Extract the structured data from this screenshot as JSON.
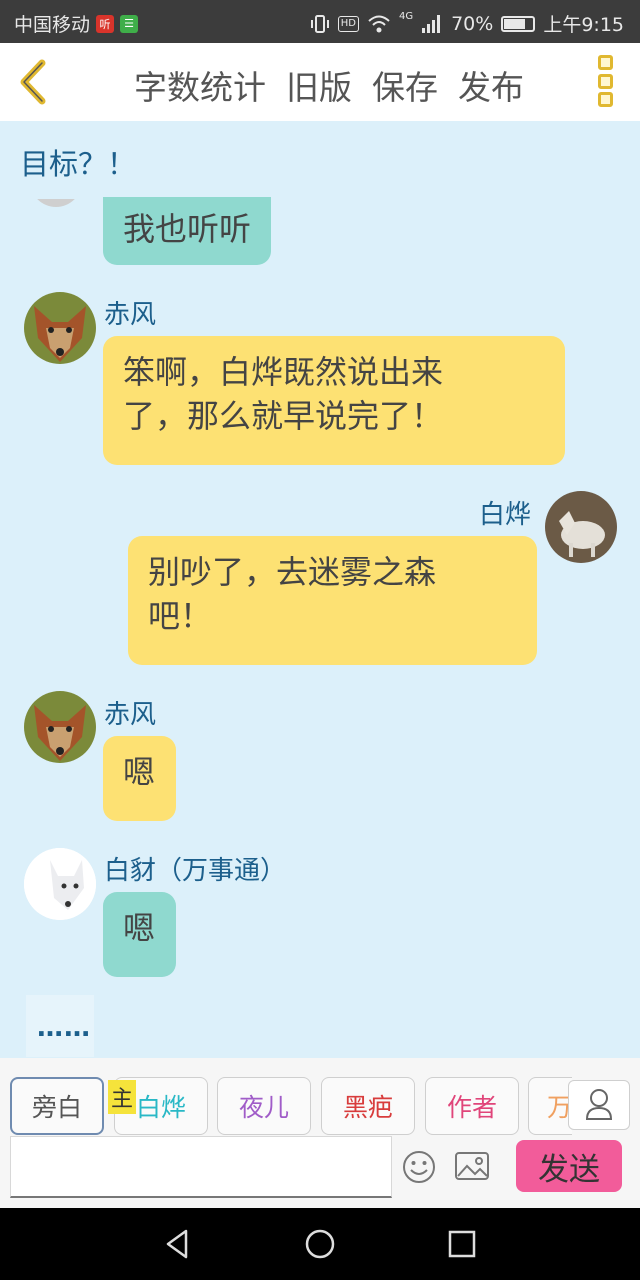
{
  "status_bar": {
    "carrier": "中国移动",
    "app1_glyph": "听",
    "app2_glyph": "☰",
    "network": "4G",
    "battery": "70%",
    "time": "上午9:15"
  },
  "toolbar": {
    "word_count": "字数统计",
    "old_version": "旧版",
    "save": "保存",
    "publish": "发布"
  },
  "chat": {
    "goal_text": "目标？！",
    "messages": [
      {
        "speaker": "",
        "text": "我也听听",
        "color": "teal",
        "side": "left"
      },
      {
        "speaker": "赤风",
        "text_line1": "笨啊，白烨既然说出来",
        "text_line2": "了，那么就早说完了！",
        "color": "yellow",
        "side": "left"
      },
      {
        "speaker": "白烨",
        "text_line1": "别吵了，去迷雾之森",
        "text_line2": "吧！",
        "color": "yellow",
        "side": "right"
      },
      {
        "speaker": "赤风",
        "text": "嗯",
        "color": "yellow",
        "side": "left"
      },
      {
        "speaker": "白豺（万事通）",
        "text": "嗯",
        "color": "teal",
        "side": "left"
      }
    ],
    "typing_dots": "……"
  },
  "roles": {
    "main_badge": "主",
    "items": [
      {
        "label": "旁白",
        "color": "#555555"
      },
      {
        "label": "白烨",
        "color": "#29b8c6"
      },
      {
        "label": "夜儿",
        "color": "#a05cc8"
      },
      {
        "label": "黑疤",
        "color": "#d83c3c"
      },
      {
        "label": "作者",
        "color": "#e0457a"
      },
      {
        "label": "万",
        "color": "#f0a060"
      }
    ]
  },
  "input": {
    "placeholder": "",
    "send_label": "发送"
  },
  "colors": {
    "chat_bg": "#dcf0fa",
    "bubble_yellow": "#fde173",
    "bubble_teal": "#8fd9cf",
    "send_button": "#f25c9a",
    "name_text": "#1c5f8c"
  }
}
